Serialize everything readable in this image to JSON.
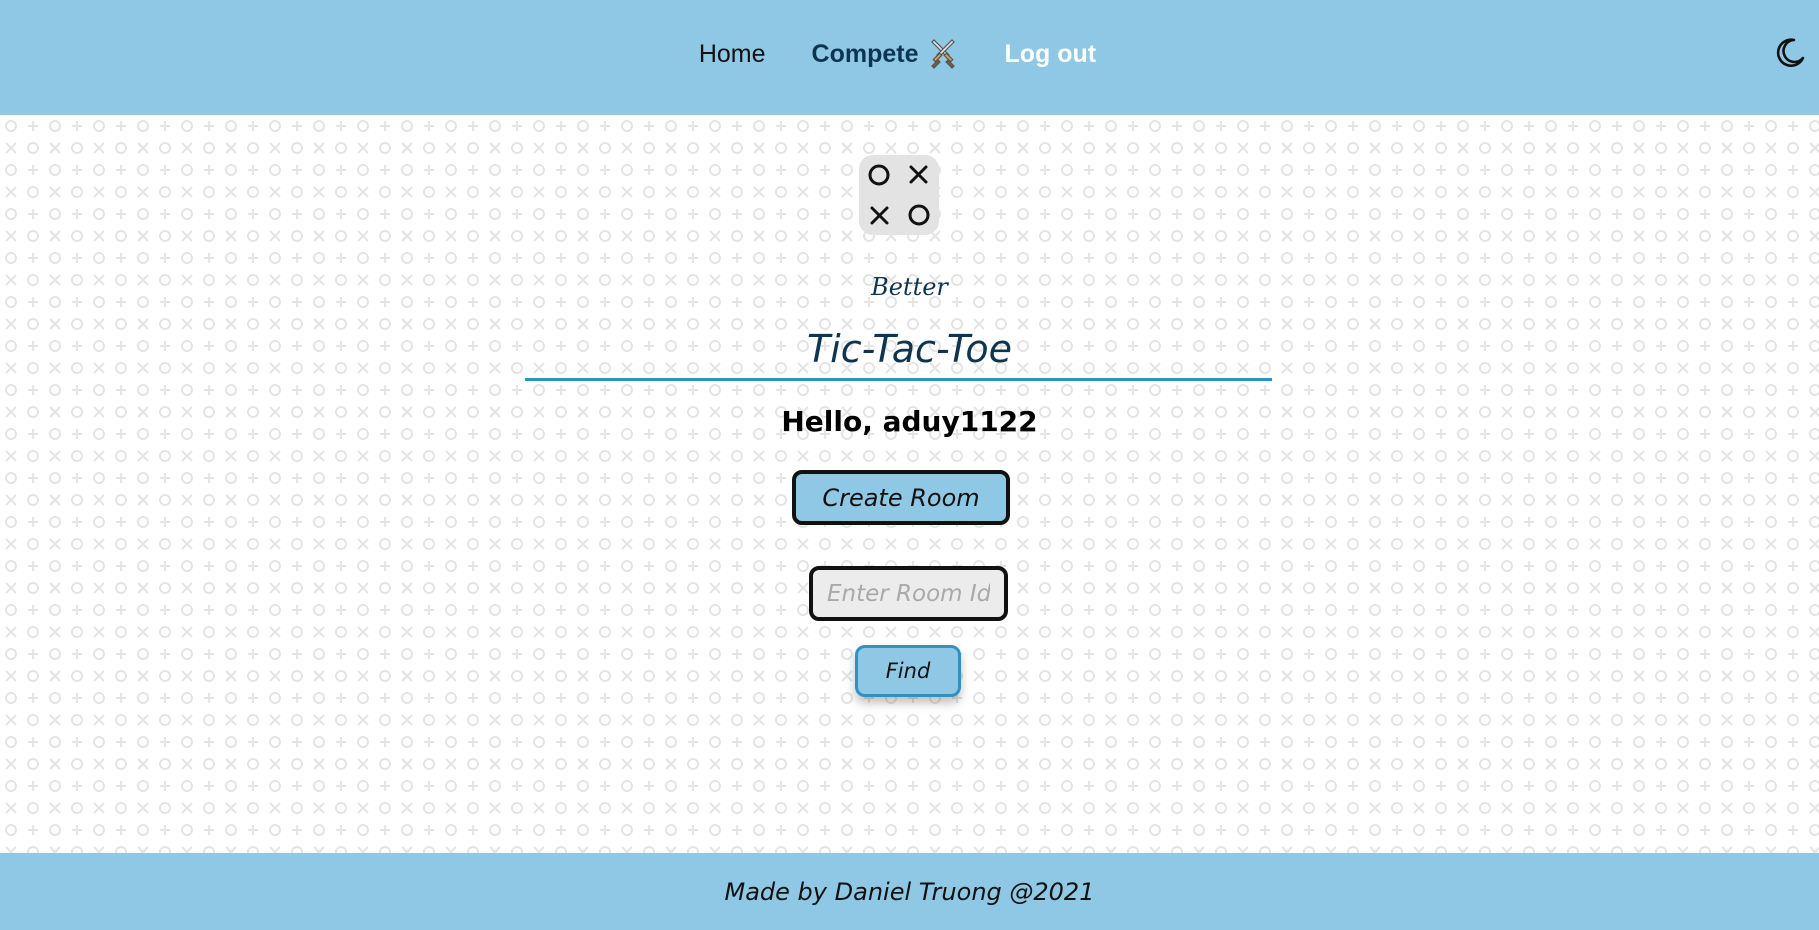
{
  "nav": {
    "home_label": "Home",
    "compete_label": "Compete",
    "logout_label": "Log out",
    "compete_icon": "crossed-swords-icon",
    "theme_icon": "moon-icon"
  },
  "hero": {
    "subtitle": "Better",
    "title": "Tic-Tac-Toe",
    "greeting": "Hello, aduy1122"
  },
  "actions": {
    "create_room_label": "Create Room",
    "room_id_placeholder": "Enter Room Id",
    "room_id_value": "",
    "find_label": "Find"
  },
  "footer": {
    "text": "Made by Daniel Truong @2021"
  },
  "colors": {
    "header_bg": "#8ec8e5",
    "accent": "#2e93c2",
    "title_text": "#0e3550",
    "pattern": "#e6e6e6"
  }
}
